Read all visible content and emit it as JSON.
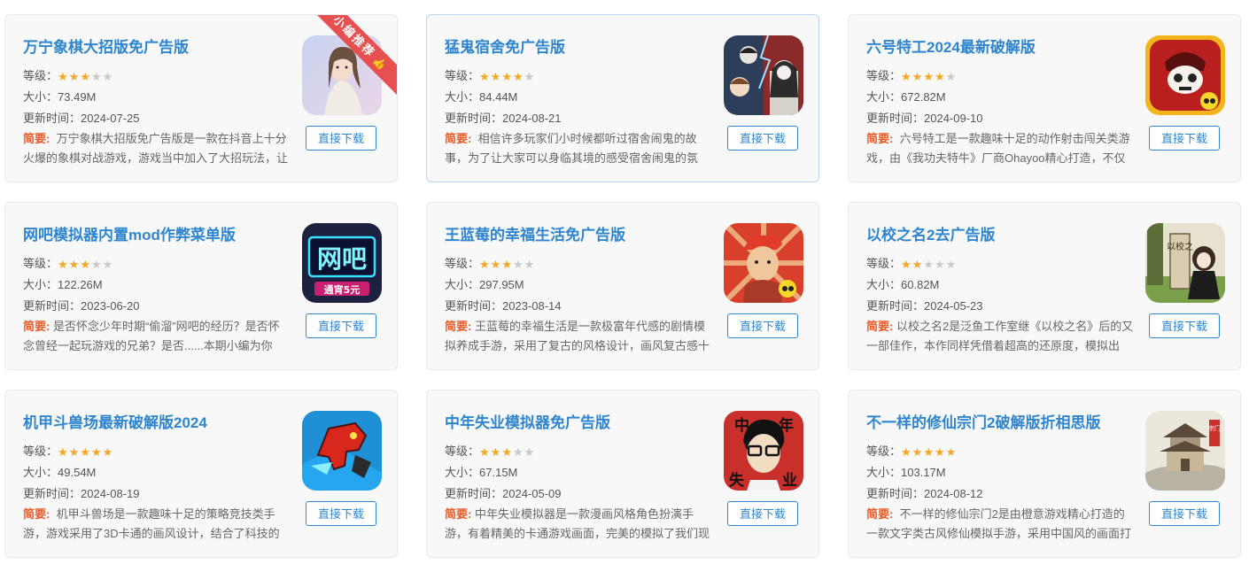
{
  "common": {
    "level_label": "等级：",
    "size_label": "大小：",
    "update_label": "更新时间：",
    "desc_label": "简要:",
    "download_label": "直接下载"
  },
  "ribbon": {
    "label": "小编推荐",
    "icon": "thumbs-up-icon"
  },
  "cards": [
    {
      "title": "万宁象棋大招版免广告版",
      "rating": 3,
      "size": "73.49M",
      "updated": "2024-07-25",
      "desc": "万宁象棋大招版免广告版是一款在抖音上十分火爆的象棋对战游戏，游戏当中加入了大招玩法，让"
    },
    {
      "title": "猛鬼宿舍免广告版",
      "rating": 4,
      "size": "84.44M",
      "updated": "2024-08-21",
      "desc": "相信许多玩家们小时候都听过宿舍闹鬼的故事，为了让大家可以身临其境的感受宿舍闹鬼的氛"
    },
    {
      "title": "六号特工2024最新破解版",
      "rating": 4,
      "size": "672.82M",
      "updated": "2024-09-10",
      "desc": "六号特工是一款趣味十足的动作射击闯关类游戏，由《我功夫特牛》厂商Ohayoo精心打造，不仅"
    },
    {
      "title": "网吧模拟器内置mod作弊菜单版",
      "rating": 3,
      "size": "122.26M",
      "updated": "2023-06-20",
      "desc": "是否怀念少年时期“偷溜”网吧的经历？是否怀念曾经一起玩游戏的兄弟？是否......本期小编为你"
    },
    {
      "title": "王蓝莓的幸福生活免广告版",
      "rating": 3,
      "size": "297.95M",
      "updated": "2023-08-14",
      "desc": "王蓝莓的幸福生活是一款极富年代感的剧情模拟养成手游，采用了复古的风格设计，画风复古感十"
    },
    {
      "title": "以校之名2去广告版",
      "rating": 2,
      "size": "60.82M",
      "updated": "2024-05-23",
      "desc": "以校之名2是泛鱼工作室继《以校之名》后的又一部佳作，本作同样凭借着超高的还原度，模拟出"
    },
    {
      "title": "机甲斗兽场最新破解版2024",
      "rating": 5,
      "size": "49.54M",
      "updated": "2024-08-19",
      "desc": "机甲斗兽场是一款趣味十足的策略竞技类手游，游戏采用了3D卡通的画风设计，结合了科技的"
    },
    {
      "title": "中年失业模拟器免广告版",
      "rating": 3,
      "size": "67.15M",
      "updated": "2024-05-09",
      "desc": "中年失业模拟器是一款漫画风格角色扮演手游，有着精美的卡通游戏画面，完美的模拟了我们现"
    },
    {
      "title": "不一样的修仙宗门2破解版折相思版",
      "rating": 5,
      "size": "103.17M",
      "updated": "2024-08-12",
      "desc": "不一样的修仙宗门2是由橙意游戏精心打造的一款文字类古风修仙模拟手游，采用中国风的画面打"
    }
  ],
  "icons": {
    "wangba_top": "网吧",
    "wangba_sign": "通宵5元",
    "school_sign": "以校之",
    "xiuxian_sign": "宗门",
    "unemployment_left": "中",
    "unemployment_right": "年",
    "unemployment_bottom_left": "失",
    "unemployment_bottom_right": "业"
  }
}
